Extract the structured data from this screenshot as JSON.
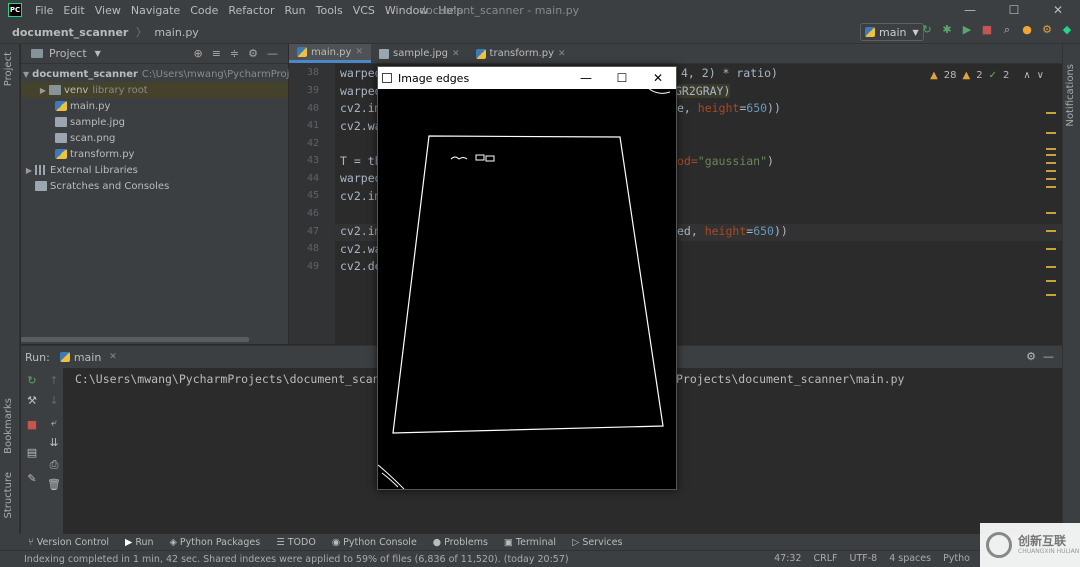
{
  "app": {
    "logo": "PC",
    "menu": [
      "File",
      "Edit",
      "View",
      "Navigate",
      "Code",
      "Refactor",
      "Run",
      "Tools",
      "VCS",
      "Window",
      "Help"
    ],
    "window_title": "document_scanner - main.py",
    "controls": [
      "—",
      "☐",
      "✕"
    ]
  },
  "navbar": {
    "project": "document_scanner",
    "file": "main.py",
    "run_config": "main"
  },
  "left_strip": {
    "project_tab": "Project",
    "bookmarks_tab": "Bookmarks",
    "structure_tab": "Structure"
  },
  "right_strip": {
    "notifications_tab": "Notifications"
  },
  "project_panel": {
    "title": "Project",
    "root": {
      "name": "document_scanner",
      "path": "C:\\Users\\mwang\\PycharmProjects"
    },
    "items": [
      {
        "name": "venv",
        "note": "library root"
      },
      {
        "name": "main.py"
      },
      {
        "name": "sample.jpg"
      },
      {
        "name": "scan.png"
      },
      {
        "name": "transform.py"
      },
      {
        "name": "External Libraries"
      },
      {
        "name": "Scratches and Consoles"
      }
    ]
  },
  "editor": {
    "tabs": [
      {
        "label": "main.py"
      },
      {
        "label": "sample.jpg"
      },
      {
        "label": "transform.py"
      }
    ],
    "line_numbers": [
      "38",
      "39",
      "40",
      "41",
      "42",
      "43",
      "44",
      "45",
      "46",
      "47",
      "48",
      "49"
    ],
    "lines": {
      "l38a": "warped",
      "l38b": "4, 2) * ratio)",
      "l39a": "warped",
      "l39b": "GR2GRAY)",
      "l40a": "cv2.im",
      "l40b": "e, ",
      "l40c": "height",
      "l40d": "=",
      "l40e": "650",
      "l40f": "))",
      "l41a": "cv2.wa",
      "l43a": "T = th",
      "l43b": "od=",
      "l43c": "\"gaussian\"",
      "l43d": ")",
      "l44a": "warped",
      "l45a": "cv2.im",
      "l47a": "cv2.im",
      "l47b": "ed, ",
      "l47c": "height",
      "l47d": "=",
      "l47e": "650",
      "l47f": "))",
      "l48a": "cv2.wa",
      "l49a": "cv2.de"
    },
    "inspections": {
      "warnings": "28",
      "weak": "2",
      "ok": "2"
    }
  },
  "run_panel": {
    "label": "Run:",
    "tab": "main",
    "console_left": "C:\\Users\\mwang\\PycharmProjects\\document_scanner\\",
    "console_right": "Projects\\document_scanner\\main.py"
  },
  "overlay_window": {
    "title": "Image edges",
    "controls": [
      "—",
      "☐",
      "✕"
    ]
  },
  "bottom_tabs": [
    "Version Control",
    "Run",
    "Python Packages",
    "TODO",
    "Python Console",
    "Problems",
    "Terminal",
    "Services"
  ],
  "status": {
    "message": "Indexing completed in 1 min, 42 sec. Shared indexes were applied to 59% of files (6,836 of 11,520). (today 20:57)",
    "position": "47:32",
    "line_sep": "CRLF",
    "encoding": "UTF-8",
    "indent": "4 spaces",
    "interpreter": "Pytho"
  },
  "watermark": {
    "text": "创新互联",
    "sub": "CHUANGXIN HULIAN"
  },
  "colors": {
    "accent": "#4a88c7",
    "bg": "#2b2b2b",
    "panel": "#3c3f41"
  }
}
